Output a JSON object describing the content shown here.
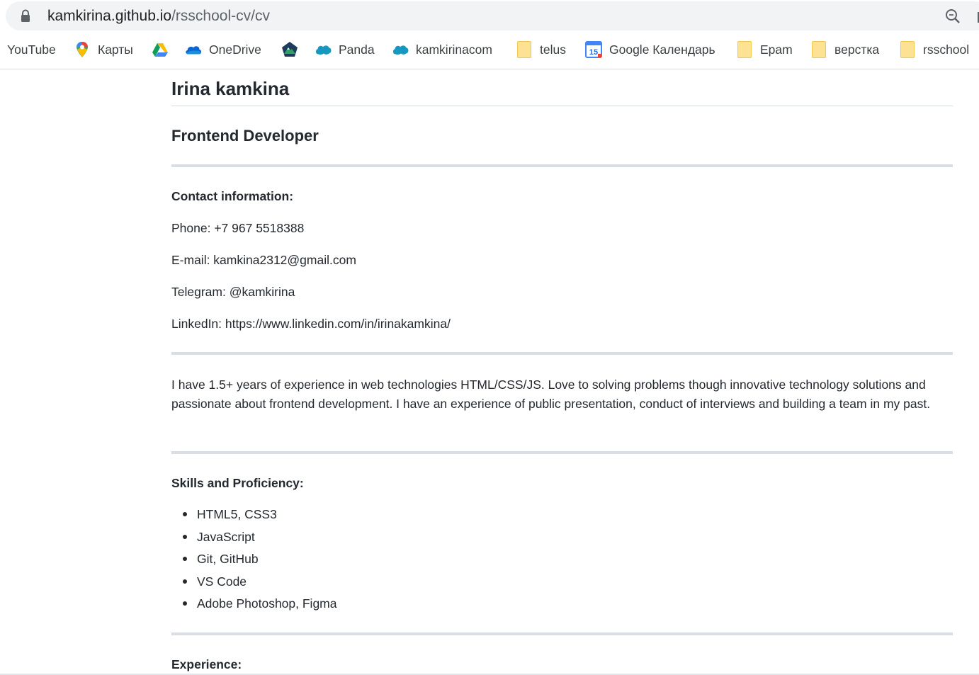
{
  "browser": {
    "url_host": "kamkirina.github.io",
    "url_path": "/rsschool-cv/cv",
    "bookmarks": [
      {
        "label": "YouTube",
        "icon": "none"
      },
      {
        "label": "Карты",
        "icon": "maps-pin-icon"
      },
      {
        "label": "",
        "icon": "google-drive-icon"
      },
      {
        "label": "OneDrive",
        "icon": "onedrive-cloud-icon"
      },
      {
        "label": "",
        "icon": "mountain-badge-icon"
      },
      {
        "label": "Panda",
        "icon": "salesforce-cloud-icon"
      },
      {
        "label": "kamkirinacom",
        "icon": "salesforce-cloud-icon"
      },
      {
        "label": "telus",
        "icon": "folder-icon"
      },
      {
        "label": "Google Календарь",
        "icon": "calendar-icon",
        "calendar_day": "15"
      },
      {
        "label": "Epam",
        "icon": "folder-icon"
      },
      {
        "label": "верстка",
        "icon": "folder-icon"
      },
      {
        "label": "rsschool",
        "icon": "folder-icon"
      }
    ]
  },
  "cv": {
    "name": "Irina kamkina",
    "title": "Frontend Developer",
    "contact_heading": "Contact information:",
    "contacts": [
      "Phone: +7 967 5518388",
      "E-mail: kamkina2312@gmail.com",
      "Telegram: @kamkirina",
      "LinkedIn: https://www.linkedin.com/in/irinakamkina/"
    ],
    "about": "I have 1.5+ years of experience in web technologies HTML/CSS/JS. Love to solving problems though innovative technology solutions and passionate about frontend development. I have an experience of public presentation, conduct of interviews and building a team in my past.",
    "skills_heading": "Skills and Proficiency:",
    "skills": [
      "HTML5, CSS3",
      "JavaScript",
      "Git, GitHub",
      "VS Code",
      "Adobe Photoshop, Figma"
    ],
    "experience_heading": "Experience:"
  },
  "colors": {
    "text": "#24292f",
    "rule": "#d8dee4",
    "omnibox_bg": "#f1f3f4",
    "folder": "#fde293"
  }
}
